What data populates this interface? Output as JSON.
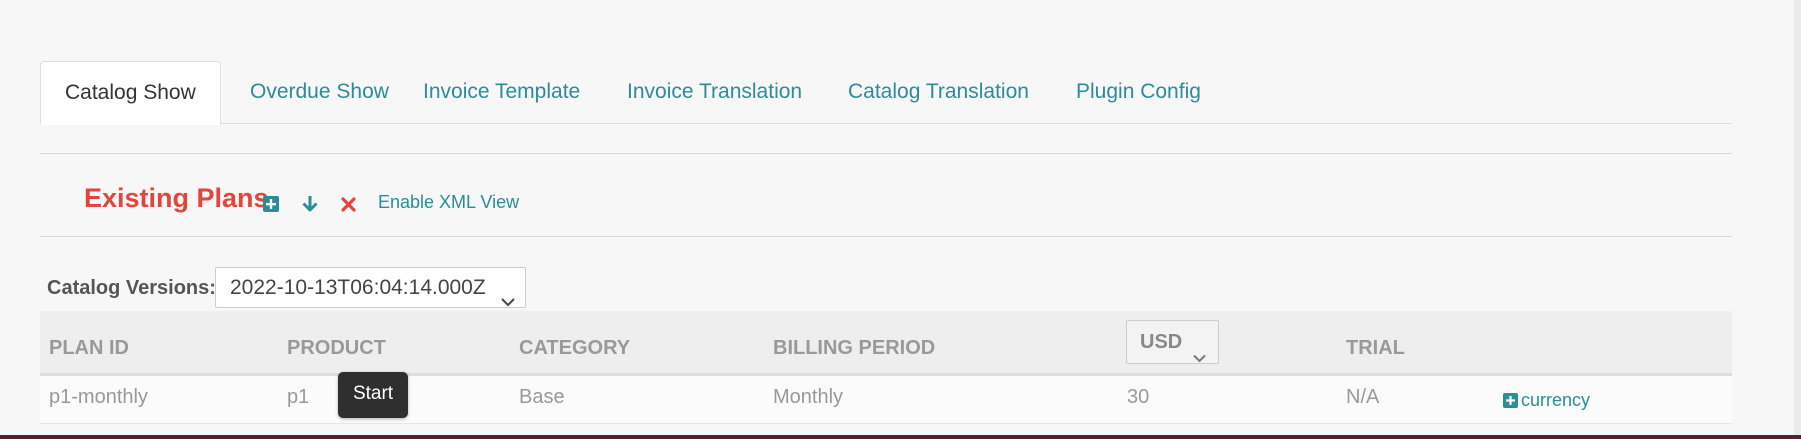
{
  "tabs": [
    {
      "label": "Catalog Show",
      "active": true
    },
    {
      "label": "Overdue Show",
      "active": false
    },
    {
      "label": "Invoice Template",
      "active": false
    },
    {
      "label": "Invoice Translation",
      "active": false
    },
    {
      "label": "Catalog Translation",
      "active": false
    },
    {
      "label": "Plugin Config",
      "active": false
    }
  ],
  "plans": {
    "title": "Existing Plans",
    "icons": [
      "plus-square-icon",
      "download-arrow-icon",
      "close-icon"
    ],
    "enable_xml_label": "Enable XML View"
  },
  "catalog_versions": {
    "label": "Catalog Versions:",
    "selected": "2022-10-13T06:04:14.000Z"
  },
  "table": {
    "headers": {
      "plan_id": "PLAN ID",
      "product": "PRODUCT",
      "category": "CATEGORY",
      "billing_period": "BILLING PERIOD",
      "currency": "USD",
      "trial": "TRIAL"
    },
    "rows": [
      {
        "plan_id": "p1-monthly",
        "product": "p1",
        "category": "Base",
        "billing_period": "Monthly",
        "price": "30",
        "trial": "N/A",
        "action_label": "currency"
      }
    ]
  },
  "tooltip": {
    "text": "Start"
  },
  "colors": {
    "accent": "#2a8d97",
    "title_red": "#e2463a",
    "tooltip_bg": "#2f2f2f"
  }
}
